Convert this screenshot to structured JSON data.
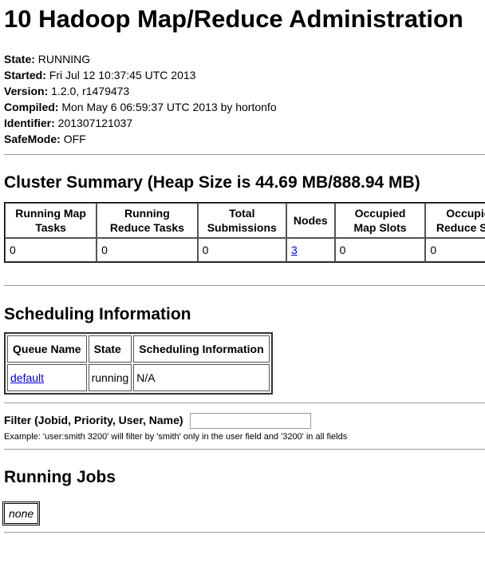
{
  "page_title": "10 Hadoop Map/Reduce Administration",
  "info": [
    {
      "label": "State:",
      "value": "RUNNING"
    },
    {
      "label": "Started:",
      "value": "Fri Jul 12 10:37:45 UTC 2013"
    },
    {
      "label": "Version:",
      "value": "1.2.0, r1479473"
    },
    {
      "label": "Compiled:",
      "value": "Mon May 6 06:59:37 UTC 2013 by hortonfo"
    },
    {
      "label": "Identifier:",
      "value": "201307121037"
    },
    {
      "label": "SafeMode:",
      "value": "OFF"
    }
  ],
  "cluster_summary": {
    "title": "Cluster Summary (Heap Size is 44.69 MB/888.94 MB)",
    "headers": [
      [
        "Running Map",
        "Tasks"
      ],
      [
        "Running",
        "Reduce Tasks"
      ],
      [
        "Total",
        "Submissions"
      ],
      [
        "Nodes",
        ""
      ],
      [
        "Occupied",
        "Map Slots"
      ],
      [
        "Occupied",
        "Reduce Slots"
      ]
    ],
    "values": [
      "0",
      "0",
      "0",
      "3",
      "0",
      "0"
    ]
  },
  "scheduling": {
    "title": "Scheduling Information",
    "headers": [
      "Queue Name",
      "State",
      "Scheduling Information"
    ],
    "rows": [
      {
        "queue": "default",
        "state": "running",
        "info": "N/A"
      }
    ]
  },
  "filter": {
    "label": "Filter (Jobid, Priority, User, Name)",
    "value": "",
    "example": "Example: 'user:smith 3200' will filter by 'smith' only in the user field and '3200' in all fields"
  },
  "running_jobs": {
    "title": "Running Jobs",
    "empty_text": "none"
  }
}
